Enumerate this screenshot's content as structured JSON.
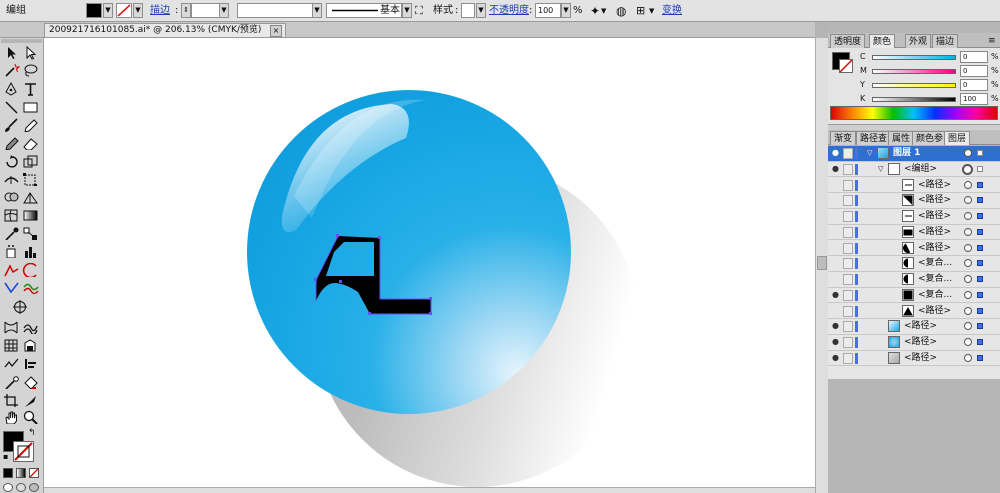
{
  "control_bar": {
    "selection_label": "编组",
    "stroke_label": "描边",
    "brush_label": "基本",
    "style_label": "样式",
    "opacity_label": "不透明度",
    "opacity_value": "100",
    "opacity_unit": "%",
    "transform_label": "变换"
  },
  "document_tab": {
    "title": "200921716101085.ai* @ 206.13% (CMYK/预览)",
    "close": "×"
  },
  "color_panel": {
    "tabs": [
      "透明度",
      "颜色",
      "外观",
      "描边"
    ],
    "active_tab": "颜色",
    "channels": [
      {
        "name": "C",
        "value": "0",
        "unit": "%"
      },
      {
        "name": "M",
        "value": "0",
        "unit": "%"
      },
      {
        "name": "Y",
        "value": "0",
        "unit": "%"
      },
      {
        "name": "K",
        "value": "100",
        "unit": "%"
      }
    ],
    "fill_color": "#000000"
  },
  "layers_panel": {
    "tabs": [
      "渐变",
      "路径查",
      "属性",
      "颜色参",
      "图层"
    ],
    "active_tab": "图层",
    "rows": [
      {
        "name": "图层 1",
        "indent": 0,
        "selected": true,
        "eye": true
      },
      {
        "name": "<编组>",
        "indent": 1,
        "selected": false,
        "eye": true
      },
      {
        "name": "<路径>",
        "indent": 2,
        "selected": false,
        "eye": false
      },
      {
        "name": "<路径>",
        "indent": 2,
        "selected": false,
        "eye": false
      },
      {
        "name": "<路径>",
        "indent": 2,
        "selected": false,
        "eye": false
      },
      {
        "name": "<路径>",
        "indent": 2,
        "selected": false,
        "eye": false
      },
      {
        "name": "<路径>",
        "indent": 2,
        "selected": false,
        "eye": false
      },
      {
        "name": "<复合...",
        "indent": 2,
        "selected": false,
        "eye": false
      },
      {
        "name": "<复合...",
        "indent": 2,
        "selected": false,
        "eye": false
      },
      {
        "name": "<复合...",
        "indent": 2,
        "selected": false,
        "eye": true
      },
      {
        "name": "<路径>",
        "indent": 2,
        "selected": false,
        "eye": false
      },
      {
        "name": "<路径>",
        "indent": 1,
        "selected": false,
        "eye": true
      },
      {
        "name": "<路径>",
        "indent": 1,
        "selected": false,
        "eye": true
      },
      {
        "name": "<路径>",
        "indent": 1,
        "selected": false,
        "eye": true
      }
    ]
  },
  "colors": {
    "sphere_light": "#d8f0fb",
    "sphere_mid": "#18a8e4",
    "sphere_dark": "#0b8fd6",
    "shadow": "#d8d8d8",
    "selection": "#6a4cff"
  }
}
